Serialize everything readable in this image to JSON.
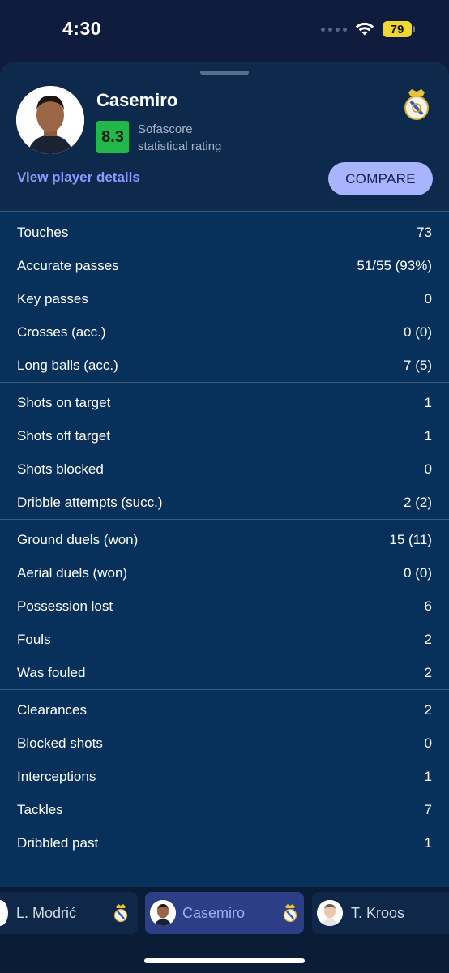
{
  "status_bar": {
    "time": "4:30",
    "battery": "79"
  },
  "player": {
    "name": "Casemiro",
    "rating": "8.3",
    "rating_caption_line1": "Sofascore",
    "rating_caption_line2": "statistical rating",
    "details_link": "View player details",
    "compare_label": "COMPARE"
  },
  "stats_groups": [
    [
      {
        "label": "Touches",
        "value": "73"
      },
      {
        "label": "Accurate passes",
        "value": "51/55 (93%)"
      },
      {
        "label": "Key passes",
        "value": "0"
      },
      {
        "label": "Crosses (acc.)",
        "value": "0 (0)"
      },
      {
        "label": "Long balls (acc.)",
        "value": "7 (5)"
      }
    ],
    [
      {
        "label": "Shots on target",
        "value": "1"
      },
      {
        "label": "Shots off target",
        "value": "1"
      },
      {
        "label": "Shots blocked",
        "value": "0"
      },
      {
        "label": "Dribble attempts (succ.)",
        "value": "2 (2)"
      }
    ],
    [
      {
        "label": "Ground duels (won)",
        "value": "15 (11)"
      },
      {
        "label": "Aerial duels (won)",
        "value": "0 (0)"
      },
      {
        "label": "Possession lost",
        "value": "6"
      },
      {
        "label": "Fouls",
        "value": "2"
      },
      {
        "label": "Was fouled",
        "value": "2"
      }
    ],
    [
      {
        "label": "Clearances",
        "value": "2"
      },
      {
        "label": "Blocked shots",
        "value": "0"
      },
      {
        "label": "Interceptions",
        "value": "1"
      },
      {
        "label": "Tackles",
        "value": "7"
      },
      {
        "label": "Dribbled past",
        "value": "1"
      }
    ]
  ],
  "player_tabs": [
    {
      "name": "L. Modrić",
      "active": false
    },
    {
      "name": "Casemiro",
      "active": true
    },
    {
      "name": "T. Kroos",
      "active": false
    }
  ],
  "colors": {
    "rating_green": "#21b84a",
    "accent_link": "#8e98ff",
    "compare_bg": "#a9b4ff",
    "active_tab_bg": "#2c3f86"
  }
}
